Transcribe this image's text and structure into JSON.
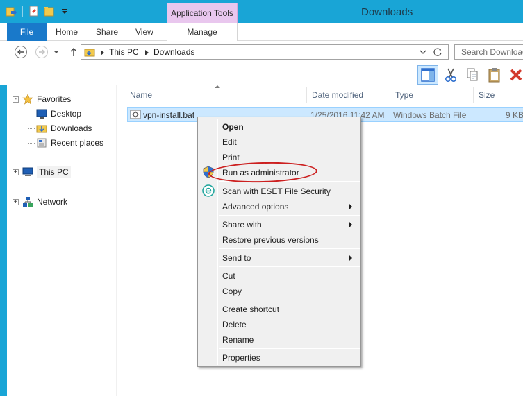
{
  "window": {
    "title": "Downloads",
    "contextual_tab_group": "Application Tools"
  },
  "ribbon": {
    "file_tab": "File",
    "tabs": [
      "Home",
      "Share",
      "View"
    ],
    "manage_tab": "Manage"
  },
  "address": {
    "crumbs": [
      "This PC",
      "Downloads"
    ],
    "search_placeholder": "Search Downloads"
  },
  "navpane": {
    "favorites": "Favorites",
    "desktop": "Desktop",
    "downloads": "Downloads",
    "recent_places": "Recent places",
    "this_pc": "This PC",
    "network": "Network"
  },
  "columns": {
    "name": "Name",
    "date_modified": "Date modified",
    "type": "Type",
    "size": "Size"
  },
  "file": {
    "name": "vpn-install.bat",
    "date": "1/25/2016 11:42 AM",
    "type": "Windows Batch File",
    "size": "9 KB"
  },
  "context_menu": {
    "open": "Open",
    "edit": "Edit",
    "print": "Print",
    "run_as_admin": "Run as administrator",
    "scan_eset": "Scan with ESET File Security",
    "advanced_options": "Advanced options",
    "share_with": "Share with",
    "restore_versions": "Restore previous versions",
    "send_to": "Send to",
    "cut": "Cut",
    "copy": "Copy",
    "create_shortcut": "Create shortcut",
    "delete": "Delete",
    "rename": "Rename",
    "properties": "Properties"
  },
  "colors": {
    "titlebar": "#19a5d6",
    "file_tab": "#1979ca",
    "contextual_tab": "#e9c7ee",
    "selection": "#cce8ff",
    "highlight_ellipse": "#cc1f1f"
  }
}
